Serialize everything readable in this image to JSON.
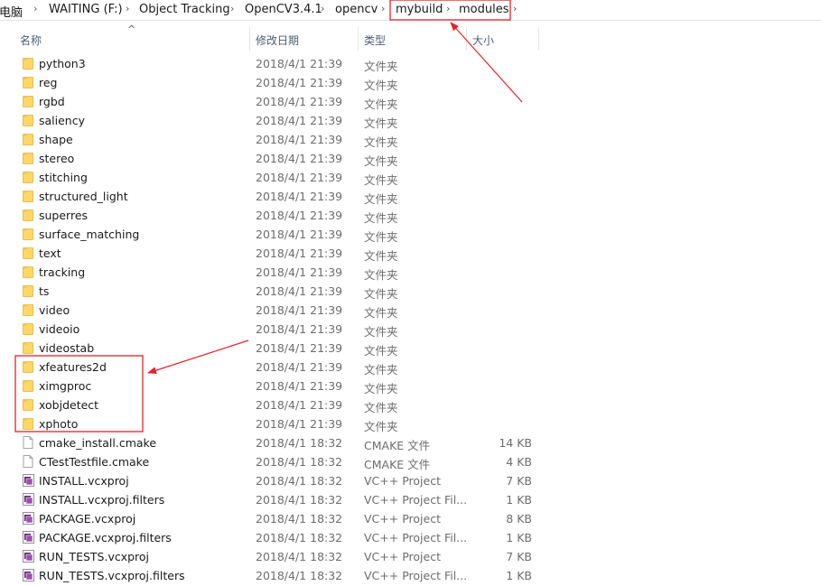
{
  "breadcrumb": [
    "此电脑",
    "WAITING (F:)",
    "Object Tracking",
    "OpenCV3.4.1",
    "opencv",
    "mybuild",
    "modules"
  ],
  "columns": {
    "name": "名称",
    "date": "修改日期",
    "type": "类型",
    "size": "大小"
  },
  "rows": [
    {
      "name": "python3",
      "date": "2018/4/1 21:39",
      "type": "文件夹",
      "size": "",
      "icon": "folder-icon"
    },
    {
      "name": "reg",
      "date": "2018/4/1 21:39",
      "type": "文件夹",
      "size": "",
      "icon": "folder-icon"
    },
    {
      "name": "rgbd",
      "date": "2018/4/1 21:39",
      "type": "文件夹",
      "size": "",
      "icon": "folder-icon"
    },
    {
      "name": "saliency",
      "date": "2018/4/1 21:39",
      "type": "文件夹",
      "size": "",
      "icon": "folder-icon"
    },
    {
      "name": "shape",
      "date": "2018/4/1 21:39",
      "type": "文件夹",
      "size": "",
      "icon": "folder-icon"
    },
    {
      "name": "stereo",
      "date": "2018/4/1 21:39",
      "type": "文件夹",
      "size": "",
      "icon": "folder-icon"
    },
    {
      "name": "stitching",
      "date": "2018/4/1 21:39",
      "type": "文件夹",
      "size": "",
      "icon": "folder-icon"
    },
    {
      "name": "structured_light",
      "date": "2018/4/1 21:39",
      "type": "文件夹",
      "size": "",
      "icon": "folder-icon"
    },
    {
      "name": "superres",
      "date": "2018/4/1 21:39",
      "type": "文件夹",
      "size": "",
      "icon": "folder-icon"
    },
    {
      "name": "surface_matching",
      "date": "2018/4/1 21:39",
      "type": "文件夹",
      "size": "",
      "icon": "folder-icon"
    },
    {
      "name": "text",
      "date": "2018/4/1 21:39",
      "type": "文件夹",
      "size": "",
      "icon": "folder-icon"
    },
    {
      "name": "tracking",
      "date": "2018/4/1 21:39",
      "type": "文件夹",
      "size": "",
      "icon": "folder-icon"
    },
    {
      "name": "ts",
      "date": "2018/4/1 21:39",
      "type": "文件夹",
      "size": "",
      "icon": "folder-icon"
    },
    {
      "name": "video",
      "date": "2018/4/1 21:39",
      "type": "文件夹",
      "size": "",
      "icon": "folder-icon"
    },
    {
      "name": "videoio",
      "date": "2018/4/1 21:39",
      "type": "文件夹",
      "size": "",
      "icon": "folder-icon"
    },
    {
      "name": "videostab",
      "date": "2018/4/1 21:39",
      "type": "文件夹",
      "size": "",
      "icon": "folder-icon"
    },
    {
      "name": "xfeatures2d",
      "date": "2018/4/1 21:39",
      "type": "文件夹",
      "size": "",
      "icon": "folder-icon"
    },
    {
      "name": "ximgproc",
      "date": "2018/4/1 21:39",
      "type": "文件夹",
      "size": "",
      "icon": "folder-icon"
    },
    {
      "name": "xobjdetect",
      "date": "2018/4/1 21:39",
      "type": "文件夹",
      "size": "",
      "icon": "folder-icon"
    },
    {
      "name": "xphoto",
      "date": "2018/4/1 21:39",
      "type": "文件夹",
      "size": "",
      "icon": "folder-icon"
    },
    {
      "name": "cmake_install.cmake",
      "date": "2018/4/1 18:32",
      "type": "CMAKE 文件",
      "size": "14 KB",
      "icon": "file-icon"
    },
    {
      "name": "CTestTestfile.cmake",
      "date": "2018/4/1 18:32",
      "type": "CMAKE 文件",
      "size": "4 KB",
      "icon": "file-icon"
    },
    {
      "name": "INSTALL.vcxproj",
      "date": "2018/4/1 18:32",
      "type": "VC++ Project",
      "size": "7 KB",
      "icon": "vcxproj-icon"
    },
    {
      "name": "INSTALL.vcxproj.filters",
      "date": "2018/4/1 18:32",
      "type": "VC++ Project Fil...",
      "size": "1 KB",
      "icon": "vcxproj-icon"
    },
    {
      "name": "PACKAGE.vcxproj",
      "date": "2018/4/1 18:32",
      "type": "VC++ Project",
      "size": "8 KB",
      "icon": "vcxproj-icon"
    },
    {
      "name": "PACKAGE.vcxproj.filters",
      "date": "2018/4/1 18:32",
      "type": "VC++ Project Fil...",
      "size": "1 KB",
      "icon": "vcxproj-icon"
    },
    {
      "name": "RUN_TESTS.vcxproj",
      "date": "2018/4/1 18:32",
      "type": "VC++ Project",
      "size": "7 KB",
      "icon": "vcxproj-icon"
    },
    {
      "name": "RUN_TESTS.vcxproj.filters",
      "date": "2018/4/1 18:32",
      "type": "VC++ Project Fil...",
      "size": "1 KB",
      "icon": "vcxproj-icon"
    }
  ],
  "colors": {
    "annotation": "#e8202a",
    "folder": "#ffd766",
    "header_text": "#4c607a"
  }
}
